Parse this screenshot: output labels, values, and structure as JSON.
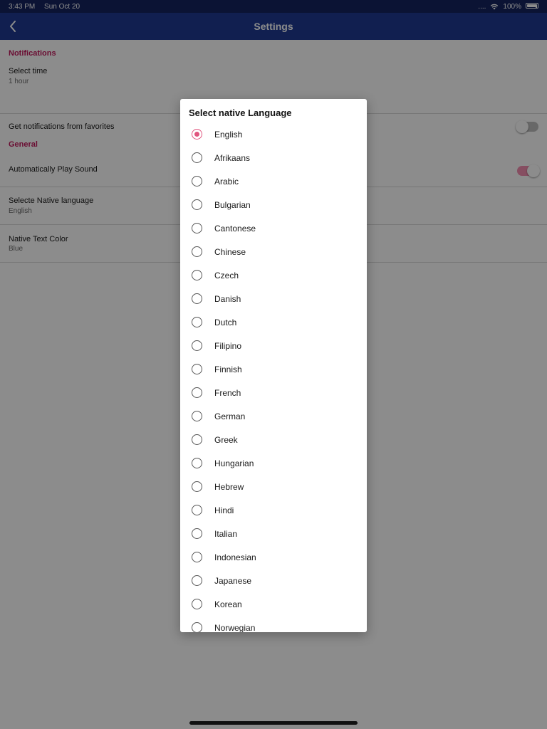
{
  "status_bar": {
    "time": "3:43 PM",
    "date": "Sun Oct 20",
    "signal": "....",
    "battery": "100%"
  },
  "nav": {
    "title": "Settings",
    "back_icon": "chevron-left-icon"
  },
  "settings": {
    "notifications_header": "Notifications",
    "select_time_title": "Select time",
    "select_time_value": "1 hour",
    "favorites_title": "Get notifications from favorites",
    "favorites_on": false,
    "general_header": "General",
    "auto_play_title": "Automatically Play Sound",
    "auto_play_on": true,
    "native_language_title": "Selecte Native language",
    "native_language_value": "English",
    "text_color_title": "Native Text Color",
    "text_color_value": "Blue"
  },
  "dialog": {
    "title": "Select native Language",
    "selected": "English",
    "options": [
      "English",
      "Afrikaans",
      "Arabic",
      "Bulgarian",
      "Cantonese",
      "Chinese",
      "Czech",
      "Danish",
      "Dutch",
      "Filipino",
      "Finnish",
      "French",
      "German",
      "Greek",
      "Hungarian",
      "Hebrew",
      "Hindi",
      "Italian",
      "Indonesian",
      "Japanese",
      "Korean",
      "Norwegian"
    ]
  },
  "colors": {
    "status_bar": "#14235f",
    "nav_bar": "#1f3a93",
    "accent": "#c2185b",
    "radio_selected": "#e0557e"
  }
}
